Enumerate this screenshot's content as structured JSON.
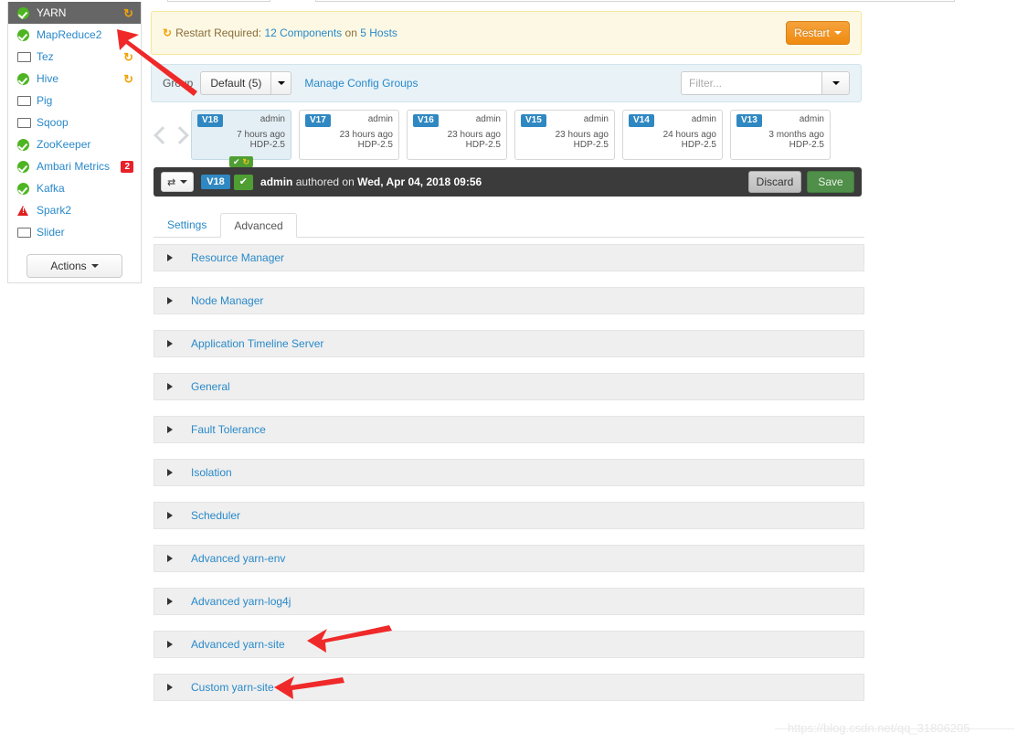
{
  "sidebar": {
    "services": [
      {
        "label": "YARN",
        "status_icon": "check-circle-icon",
        "active": true,
        "restart": true,
        "badge": null
      },
      {
        "label": "MapReduce2",
        "status_icon": "check-circle-icon",
        "active": false,
        "restart": false,
        "badge": null
      },
      {
        "label": "Tez",
        "status_icon": "monitor-icon",
        "active": false,
        "restart": true,
        "badge": null
      },
      {
        "label": "Hive",
        "status_icon": "check-circle-icon",
        "active": false,
        "restart": true,
        "badge": null
      },
      {
        "label": "Pig",
        "status_icon": "monitor-icon",
        "active": false,
        "restart": false,
        "badge": null
      },
      {
        "label": "Sqoop",
        "status_icon": "monitor-icon",
        "active": false,
        "restart": false,
        "badge": null
      },
      {
        "label": "ZooKeeper",
        "status_icon": "check-circle-icon",
        "active": false,
        "restart": false,
        "badge": null
      },
      {
        "label": "Ambari Metrics",
        "status_icon": "check-circle-icon",
        "active": false,
        "restart": false,
        "badge": "2"
      },
      {
        "label": "Kafka",
        "status_icon": "check-circle-icon",
        "active": false,
        "restart": false,
        "badge": null
      },
      {
        "label": "Spark2",
        "status_icon": "warning-triangle-icon",
        "active": false,
        "restart": false,
        "badge": null
      },
      {
        "label": "Slider",
        "status_icon": "monitor-icon",
        "active": false,
        "restart": false,
        "badge": null
      }
    ],
    "actions_label": "Actions"
  },
  "alert": {
    "restart_icon": "restart-icon",
    "prefix": "Restart Required:",
    "components": "12 Components",
    "on": "on",
    "hosts": "5 Hosts",
    "restart_button": "Restart"
  },
  "group_bar": {
    "label": "Group",
    "selected": "Default (5)",
    "manage_link": "Manage Config Groups",
    "filter_placeholder": "Filter...",
    "filter_value": ""
  },
  "versions": {
    "prev_icon": "chevron-left-icon",
    "next_icon": "chevron-right-icon",
    "cards": [
      {
        "tag": "V18",
        "author": "admin",
        "age": "7 hours ago",
        "stack": "HDP-2.5",
        "current": true,
        "badge_check": "✔",
        "badge_restart": "↻"
      },
      {
        "tag": "V17",
        "author": "admin",
        "age": "23 hours ago",
        "stack": "HDP-2.5",
        "current": false
      },
      {
        "tag": "V16",
        "author": "admin",
        "age": "23 hours ago",
        "stack": "HDP-2.5",
        "current": false
      },
      {
        "tag": "V15",
        "author": "admin",
        "age": "23 hours ago",
        "stack": "HDP-2.5",
        "current": false
      },
      {
        "tag": "V14",
        "author": "admin",
        "age": "24 hours ago",
        "stack": "HDP-2.5",
        "current": false
      },
      {
        "tag": "V13",
        "author": "admin",
        "age": "3 months ago",
        "stack": "HDP-2.5",
        "current": false
      }
    ]
  },
  "config_bar": {
    "compare_icon": "compare-icon",
    "version_tag": "V18",
    "check_glyph": "✔",
    "author": "admin",
    "authored_on": "authored on",
    "timestamp": "Wed, Apr 04, 2018 09:56",
    "discard_label": "Discard",
    "save_label": "Save"
  },
  "tabs": [
    {
      "label": "Settings",
      "active": false
    },
    {
      "label": "Advanced",
      "active": true
    }
  ],
  "accordion": [
    {
      "label": "Resource Manager"
    },
    {
      "label": "Node Manager"
    },
    {
      "label": "Application Timeline Server"
    },
    {
      "label": "General"
    },
    {
      "label": "Fault Tolerance"
    },
    {
      "label": "Isolation"
    },
    {
      "label": "Scheduler"
    },
    {
      "label": "Advanced yarn-env"
    },
    {
      "label": "Advanced yarn-log4j"
    },
    {
      "label": "Advanced yarn-site"
    },
    {
      "label": "Custom yarn-site"
    }
  ],
  "watermark": "https://blog.csdn.net/qq_31806205",
  "colors": {
    "accent_blue": "#2989c9",
    "version_tag_blue": "#2f88c2",
    "ok_green": "#4eb522",
    "save_green": "#4f8f49",
    "restart_orange": "#f0a30a",
    "restart_button_orange": "#ef8b10",
    "alert_bg": "#fcf8e3",
    "group_bar_bg": "#e9f2f7",
    "dark_bar": "#3b3b3b",
    "accordion_bg": "#efefef",
    "badge_red": "#e8202a",
    "annotation_red": "#ef2929"
  }
}
